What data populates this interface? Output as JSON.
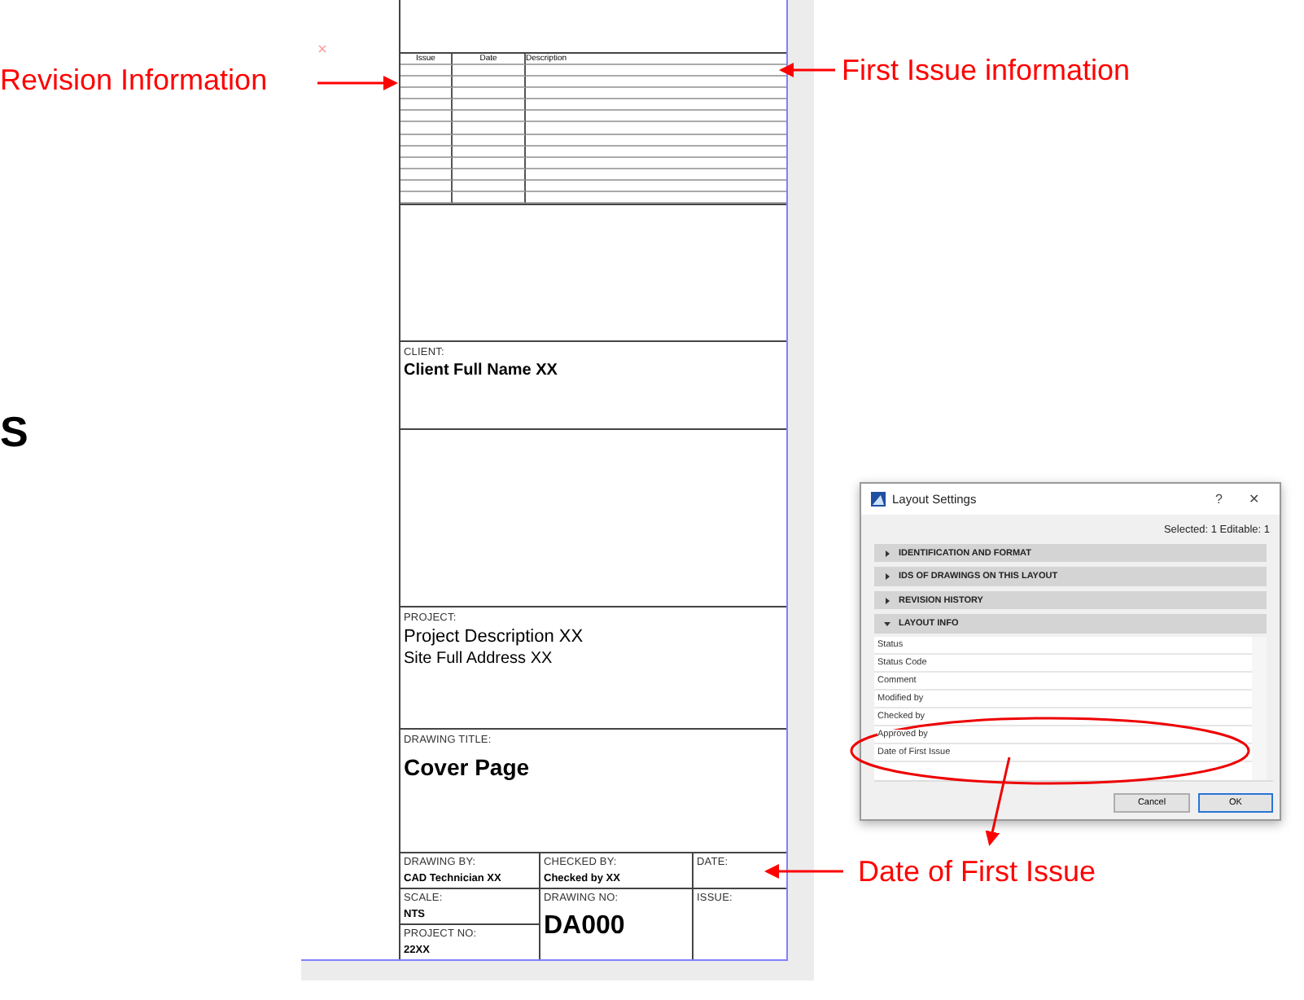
{
  "cut_letter": "S",
  "sheet": {
    "revision_table": {
      "columns": [
        "Issue",
        "Date",
        "Description"
      ]
    },
    "client": {
      "label": "CLIENT:",
      "value": "Client Full Name XX"
    },
    "project": {
      "label": "PROJECT:",
      "value": "Project Description XX",
      "address": "Site Full Address XX"
    },
    "drawing_title": {
      "label": "DRAWING TITLE:",
      "value": "Cover Page"
    },
    "drawing_by": {
      "label": "DRAWING BY:",
      "value": "CAD Technician XX"
    },
    "checked_by": {
      "label": "CHECKED BY:",
      "value": "Checked by XX"
    },
    "date": {
      "label": "DATE:"
    },
    "scale": {
      "label": "SCALE:",
      "value": "NTS"
    },
    "project_no": {
      "label": "PROJECT NO:",
      "value": "22XX"
    },
    "drawing_no": {
      "label": "DRAWING NO:",
      "value": "DA000"
    },
    "issue": {
      "label": "ISSUE:"
    }
  },
  "dialog": {
    "title": "Layout Settings",
    "help": "?",
    "close": "✕",
    "selection": "Selected: 1 Editable: 1",
    "sections": [
      {
        "label": "IDENTIFICATION AND FORMAT",
        "expanded": false
      },
      {
        "label": "IDS OF DRAWINGS ON THIS LAYOUT",
        "expanded": false
      },
      {
        "label": "REVISION HISTORY",
        "expanded": false
      },
      {
        "label": "LAYOUT INFO",
        "expanded": true
      }
    ],
    "fields": [
      "Status",
      "Status Code",
      "Comment",
      "Modified by",
      "Checked by",
      "Approved by",
      "Date of First Issue"
    ],
    "buttons": [
      {
        "label": "Cancel",
        "default": false
      },
      {
        "label": "OK",
        "default": true
      }
    ]
  },
  "annotations": [
    {
      "text": "Revision Information"
    },
    {
      "text": "First Issue information"
    },
    {
      "text": "Date of First Issue"
    }
  ]
}
